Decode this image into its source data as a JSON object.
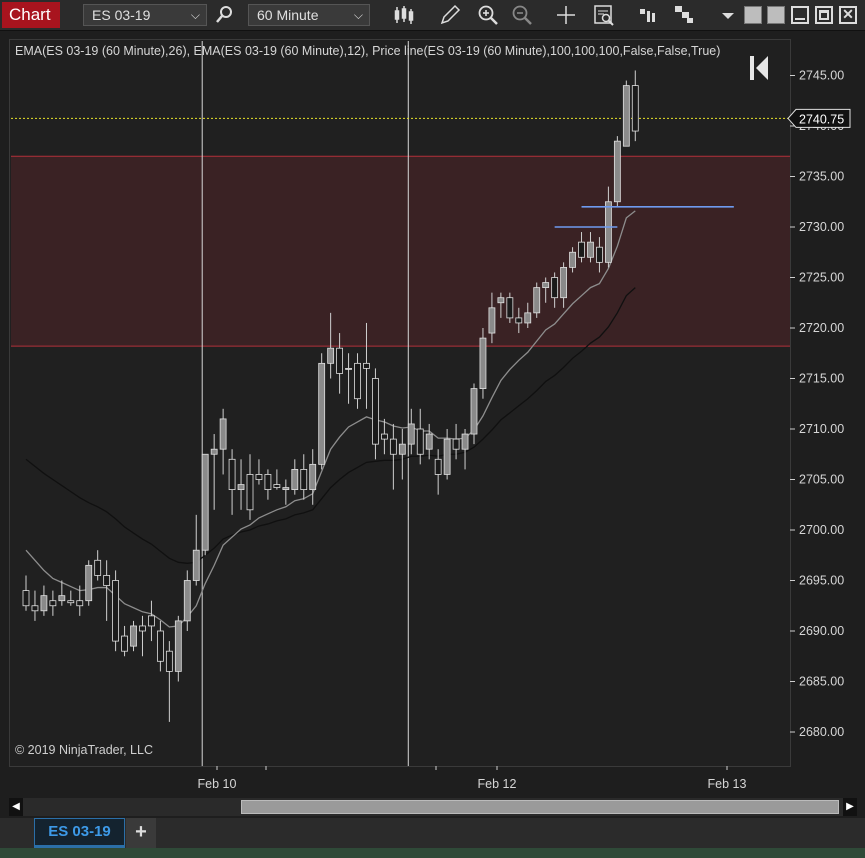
{
  "toolbar": {
    "chart_label": "Chart",
    "instrument": "ES 03-19",
    "interval": "60 Minute",
    "icons": [
      "search-icon",
      "bar-type-icon",
      "draw-pencil-icon",
      "zoom-in-icon",
      "zoom-out-icon",
      "crosshair-icon",
      "data-box-icon",
      "order-icon",
      "strategy-icon",
      "dropdown-icon"
    ],
    "window_buttons": [
      "minimize",
      "restore",
      "close"
    ]
  },
  "indicators_label": "EMA(ES 03-19 (60 Minute),26), EMA(ES 03-19 (60 Minute),12), Price line(ES 03-19 (60 Minute),100,100,100,False,False,True)",
  "copyright": "© 2019 NinjaTrader, LLC",
  "price_marker": "2740.75",
  "bottom_tab": {
    "label": "ES 03-19",
    "add_label": "+"
  },
  "colors": {
    "zone": "#3a2224",
    "zone_line": "#b2303a",
    "price_line": "#e6e22a",
    "level_line": "#6e9aef",
    "candle_up": "#8a8a8a",
    "candle_down": "#1a1a1a",
    "ema_fast": "#8d8d8d",
    "ema_slow": "#101010"
  },
  "chart_data": {
    "type": "candlestick",
    "y_ticks": [
      "2745.00",
      "2740.00",
      "2735.00",
      "2730.00",
      "2725.00",
      "2720.00",
      "2715.00",
      "2710.00",
      "2705.00",
      "2700.00",
      "2695.00",
      "2690.00",
      "2685.00",
      "2680.00"
    ],
    "x_ticks": [
      "Feb 10",
      "Feb 12",
      "Feb 13"
    ],
    "ylim": [
      2677.5,
      2747.5
    ],
    "candles": [
      {
        "o": 2694.0,
        "h": 2695.5,
        "l": 2692.0,
        "c": 2692.5
      },
      {
        "o": 2692.5,
        "h": 2694.0,
        "l": 2691.0,
        "c": 2692.0
      },
      {
        "o": 2692.0,
        "h": 2694.5,
        "l": 2691.5,
        "c": 2693.5
      },
      {
        "o": 2693.0,
        "h": 2694.0,
        "l": 2691.5,
        "c": 2692.5
      },
      {
        "o": 2693.0,
        "h": 2695.0,
        "l": 2692.5,
        "c": 2693.5
      },
      {
        "o": 2693.0,
        "h": 2694.0,
        "l": 2692.5,
        "c": 2692.8
      },
      {
        "o": 2693.0,
        "h": 2694.5,
        "l": 2691.5,
        "c": 2692.5
      },
      {
        "o": 2693.0,
        "h": 2697.0,
        "l": 2692.5,
        "c": 2696.5
      },
      {
        "o": 2697.0,
        "h": 2698.0,
        "l": 2695.0,
        "c": 2695.5
      },
      {
        "o": 2695.5,
        "h": 2697.0,
        "l": 2691.0,
        "c": 2694.5
      },
      {
        "o": 2695.0,
        "h": 2696.0,
        "l": 2688.0,
        "c": 2689.0
      },
      {
        "o": 2689.5,
        "h": 2690.5,
        "l": 2687.5,
        "c": 2688.0
      },
      {
        "o": 2688.5,
        "h": 2691.0,
        "l": 2688.0,
        "c": 2690.5
      },
      {
        "o": 2690.5,
        "h": 2691.5,
        "l": 2687.5,
        "c": 2690.0
      },
      {
        "o": 2691.5,
        "h": 2693.0,
        "l": 2689.0,
        "c": 2690.5
      },
      {
        "o": 2690.0,
        "h": 2691.0,
        "l": 2686.0,
        "c": 2687.0
      },
      {
        "o": 2688.0,
        "h": 2689.0,
        "l": 2681.0,
        "c": 2686.0
      },
      {
        "o": 2686.0,
        "h": 2691.5,
        "l": 2685.0,
        "c": 2691.0
      },
      {
        "o": 2691.0,
        "h": 2696.0,
        "l": 2690.0,
        "c": 2695.0
      },
      {
        "o": 2695.0,
        "h": 2701.5,
        "l": 2694.5,
        "c": 2698.0
      },
      {
        "o": 2698.0,
        "h": 2707.5,
        "l": 2697.5,
        "c": 2707.5
      },
      {
        "o": 2707.5,
        "h": 2709.5,
        "l": 2702.0,
        "c": 2708.0
      },
      {
        "o": 2708.0,
        "h": 2712.0,
        "l": 2705.5,
        "c": 2711.0
      },
      {
        "o": 2707.0,
        "h": 2708.0,
        "l": 2701.5,
        "c": 2704.0
      },
      {
        "o": 2704.0,
        "h": 2707.0,
        "l": 2702.0,
        "c": 2704.5
      },
      {
        "o": 2705.5,
        "h": 2707.5,
        "l": 2701.0,
        "c": 2702.0
      },
      {
        "o": 2705.5,
        "h": 2707.0,
        "l": 2704.5,
        "c": 2705.0
      },
      {
        "o": 2705.5,
        "h": 2706.0,
        "l": 2703.0,
        "c": 2704.0
      },
      {
        "o": 2704.5,
        "h": 2706.0,
        "l": 2704.0,
        "c": 2704.2
      },
      {
        "o": 2704.0,
        "h": 2705.0,
        "l": 2702.5,
        "c": 2704.2
      },
      {
        "o": 2704.0,
        "h": 2707.0,
        "l": 2703.5,
        "c": 2706.0
      },
      {
        "o": 2706.0,
        "h": 2707.5,
        "l": 2703.0,
        "c": 2704.0
      },
      {
        "o": 2704.0,
        "h": 2708.0,
        "l": 2702.5,
        "c": 2706.5
      },
      {
        "o": 2706.5,
        "h": 2717.5,
        "l": 2706.0,
        "c": 2716.5
      },
      {
        "o": 2716.5,
        "h": 2721.5,
        "l": 2715.0,
        "c": 2718.0
      },
      {
        "o": 2718.0,
        "h": 2719.5,
        "l": 2713.5,
        "c": 2715.5
      },
      {
        "o": 2716.0,
        "h": 2717.5,
        "l": 2712.5,
        "c": 2716.0
      },
      {
        "o": 2716.5,
        "h": 2717.5,
        "l": 2712.0,
        "c": 2713.0
      },
      {
        "o": 2716.5,
        "h": 2720.5,
        "l": 2712.0,
        "c": 2716.0
      },
      {
        "o": 2715.0,
        "h": 2716.0,
        "l": 2707.0,
        "c": 2708.5
      },
      {
        "o": 2709.5,
        "h": 2711.0,
        "l": 2707.5,
        "c": 2709.0
      },
      {
        "o": 2709.0,
        "h": 2710.5,
        "l": 2704.0,
        "c": 2707.5
      },
      {
        "o": 2707.5,
        "h": 2710.0,
        "l": 2705.0,
        "c": 2708.5
      },
      {
        "o": 2708.5,
        "h": 2712.0,
        "l": 2707.5,
        "c": 2710.5
      },
      {
        "o": 2710.0,
        "h": 2712.0,
        "l": 2706.5,
        "c": 2707.5
      },
      {
        "o": 2708.0,
        "h": 2710.5,
        "l": 2707.0,
        "c": 2709.5
      },
      {
        "o": 2707.0,
        "h": 2708.0,
        "l": 2703.5,
        "c": 2705.5
      },
      {
        "o": 2705.5,
        "h": 2710.0,
        "l": 2705.0,
        "c": 2709.0
      },
      {
        "o": 2709.0,
        "h": 2710.5,
        "l": 2707.0,
        "c": 2708.0
      },
      {
        "o": 2708.0,
        "h": 2710.0,
        "l": 2706.0,
        "c": 2709.5
      },
      {
        "o": 2709.5,
        "h": 2714.5,
        "l": 2708.5,
        "c": 2714.0
      },
      {
        "o": 2714.0,
        "h": 2720.0,
        "l": 2713.0,
        "c": 2719.0
      },
      {
        "o": 2719.5,
        "h": 2723.5,
        "l": 2718.5,
        "c": 2722.0
      },
      {
        "o": 2722.5,
        "h": 2723.5,
        "l": 2721.0,
        "c": 2723.0
      },
      {
        "o": 2723.0,
        "h": 2723.5,
        "l": 2720.5,
        "c": 2721.0
      },
      {
        "o": 2721.0,
        "h": 2722.0,
        "l": 2719.5,
        "c": 2720.5
      },
      {
        "o": 2720.5,
        "h": 2722.5,
        "l": 2720.0,
        "c": 2721.5
      },
      {
        "o": 2721.5,
        "h": 2724.5,
        "l": 2721.0,
        "c": 2724.0
      },
      {
        "o": 2724.0,
        "h": 2725.0,
        "l": 2722.5,
        "c": 2724.5
      },
      {
        "o": 2725.0,
        "h": 2725.5,
        "l": 2722.0,
        "c": 2723.0
      },
      {
        "o": 2723.0,
        "h": 2726.5,
        "l": 2722.0,
        "c": 2726.0
      },
      {
        "o": 2726.0,
        "h": 2728.0,
        "l": 2725.5,
        "c": 2727.5
      },
      {
        "o": 2728.5,
        "h": 2729.5,
        "l": 2726.5,
        "c": 2727.0
      },
      {
        "o": 2727.0,
        "h": 2729.5,
        "l": 2726.5,
        "c": 2728.5
      },
      {
        "o": 2728.0,
        "h": 2729.0,
        "l": 2725.5,
        "c": 2726.5
      },
      {
        "o": 2726.5,
        "h": 2734.0,
        "l": 2726.0,
        "c": 2732.5
      },
      {
        "o": 2732.5,
        "h": 2739.0,
        "l": 2732.0,
        "c": 2738.5
      },
      {
        "o": 2738.0,
        "h": 2744.5,
        "l": 2738.0,
        "c": 2744.0
      },
      {
        "o": 2744.0,
        "h": 2745.5,
        "l": 2738.5,
        "c": 2739.5
      }
    ],
    "ema_fast": [
      2698.0,
      2697.0,
      2696.0,
      2695.2,
      2694.8,
      2694.4,
      2694.0,
      2694.1,
      2694.3,
      2694.3,
      2693.5,
      2692.7,
      2692.3,
      2691.9,
      2691.7,
      2691.1,
      2690.4,
      2690.5,
      2691.4,
      2692.5,
      2694.7,
      2696.5,
      2698.5,
      2699.3,
      2700.1,
      2700.5,
      2701.2,
      2701.6,
      2702.0,
      2702.3,
      2702.9,
      2703.1,
      2703.6,
      2705.8,
      2708.0,
      2709.2,
      2710.2,
      2710.7,
      2711.2,
      2710.9,
      2710.7,
      2710.3,
      2710.1,
      2710.2,
      2709.8,
      2709.8,
      2709.1,
      2709.1,
      2709.0,
      2709.1,
      2709.9,
      2711.3,
      2713.1,
      2714.8,
      2715.9,
      2716.8,
      2717.6,
      2718.7,
      2719.8,
      2720.4,
      2721.4,
      2722.4,
      2723.2,
      2724.0,
      2724.4,
      2725.9,
      2728.1,
      2730.9,
      2731.6
    ],
    "ema_slow": [
      2707.0,
      2706.3,
      2705.6,
      2705.0,
      2704.4,
      2703.8,
      2703.2,
      2702.7,
      2702.3,
      2701.8,
      2701.1,
      2700.3,
      2699.7,
      2699.1,
      2698.6,
      2697.9,
      2697.2,
      2696.8,
      2696.7,
      2696.8,
      2697.5,
      2698.2,
      2699.1,
      2699.5,
      2699.8,
      2700.0,
      2700.4,
      2700.6,
      2700.9,
      2701.1,
      2701.5,
      2701.7,
      2702.0,
      2703.1,
      2704.2,
      2705.0,
      2705.7,
      2706.2,
      2706.7,
      2706.8,
      2706.9,
      2706.9,
      2707.0,
      2707.3,
      2707.3,
      2707.4,
      2707.3,
      2707.5,
      2707.5,
      2707.7,
      2708.2,
      2709.0,
      2709.9,
      2710.9,
      2711.6,
      2712.3,
      2713.0,
      2713.8,
      2714.7,
      2715.3,
      2716.1,
      2717.0,
      2717.7,
      2718.5,
      2719.1,
      2720.1,
      2721.5,
      2723.2,
      2724.0
    ],
    "zone": {
      "top": 2737.0,
      "bottom": 2718.2
    },
    "last_price": 2740.75,
    "levels": [
      {
        "price": 2732.0,
        "from_index": 62,
        "to_index": 79
      },
      {
        "price": 2730.0,
        "from_index": 59,
        "to_index": 66
      }
    ],
    "session_breaks": [
      20,
      43
    ]
  }
}
